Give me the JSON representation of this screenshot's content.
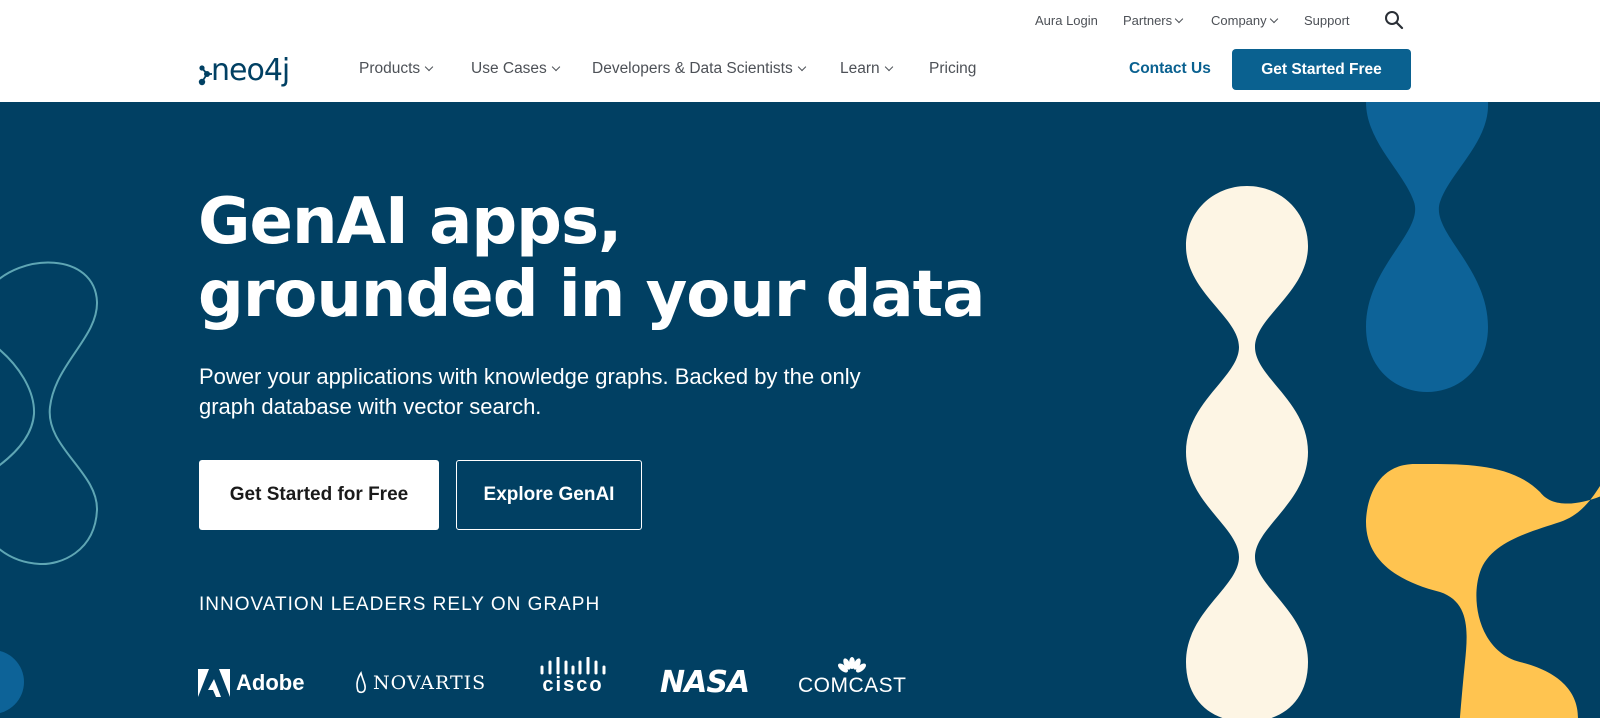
{
  "utility_nav": {
    "aura_login": "Aura Login",
    "partners": "Partners",
    "company": "Company",
    "support": "Support",
    "search_icon": "search-icon"
  },
  "main_nav": {
    "logo_text": "neo4j",
    "items": [
      "Products",
      "Use Cases",
      "Developers & Data Scientists",
      "Learn",
      "Pricing"
    ],
    "contact_us": "Contact Us",
    "get_started": "Get Started Free"
  },
  "hero": {
    "title_line1": "GenAI apps,",
    "title_line2": "grounded in your data",
    "subtitle": "Power your applications with knowledge graphs. Backed by the only graph database with vector search.",
    "primary_cta": "Get Started for Free",
    "secondary_cta": "Explore GenAI",
    "leaders_heading": "INNOVATION LEADERS RELY ON GRAPH",
    "customer_logos": [
      "Adobe",
      "NOVARTIS",
      "cisco",
      "NASA",
      "COMCAST"
    ]
  },
  "colors": {
    "brand_blue": "#0a6190",
    "hero_bg": "#014063",
    "cream": "#fdf5e4",
    "yellow": "#ffc450",
    "mid_blue": "#0d6398",
    "teal_outline": "#5fa6b4"
  }
}
